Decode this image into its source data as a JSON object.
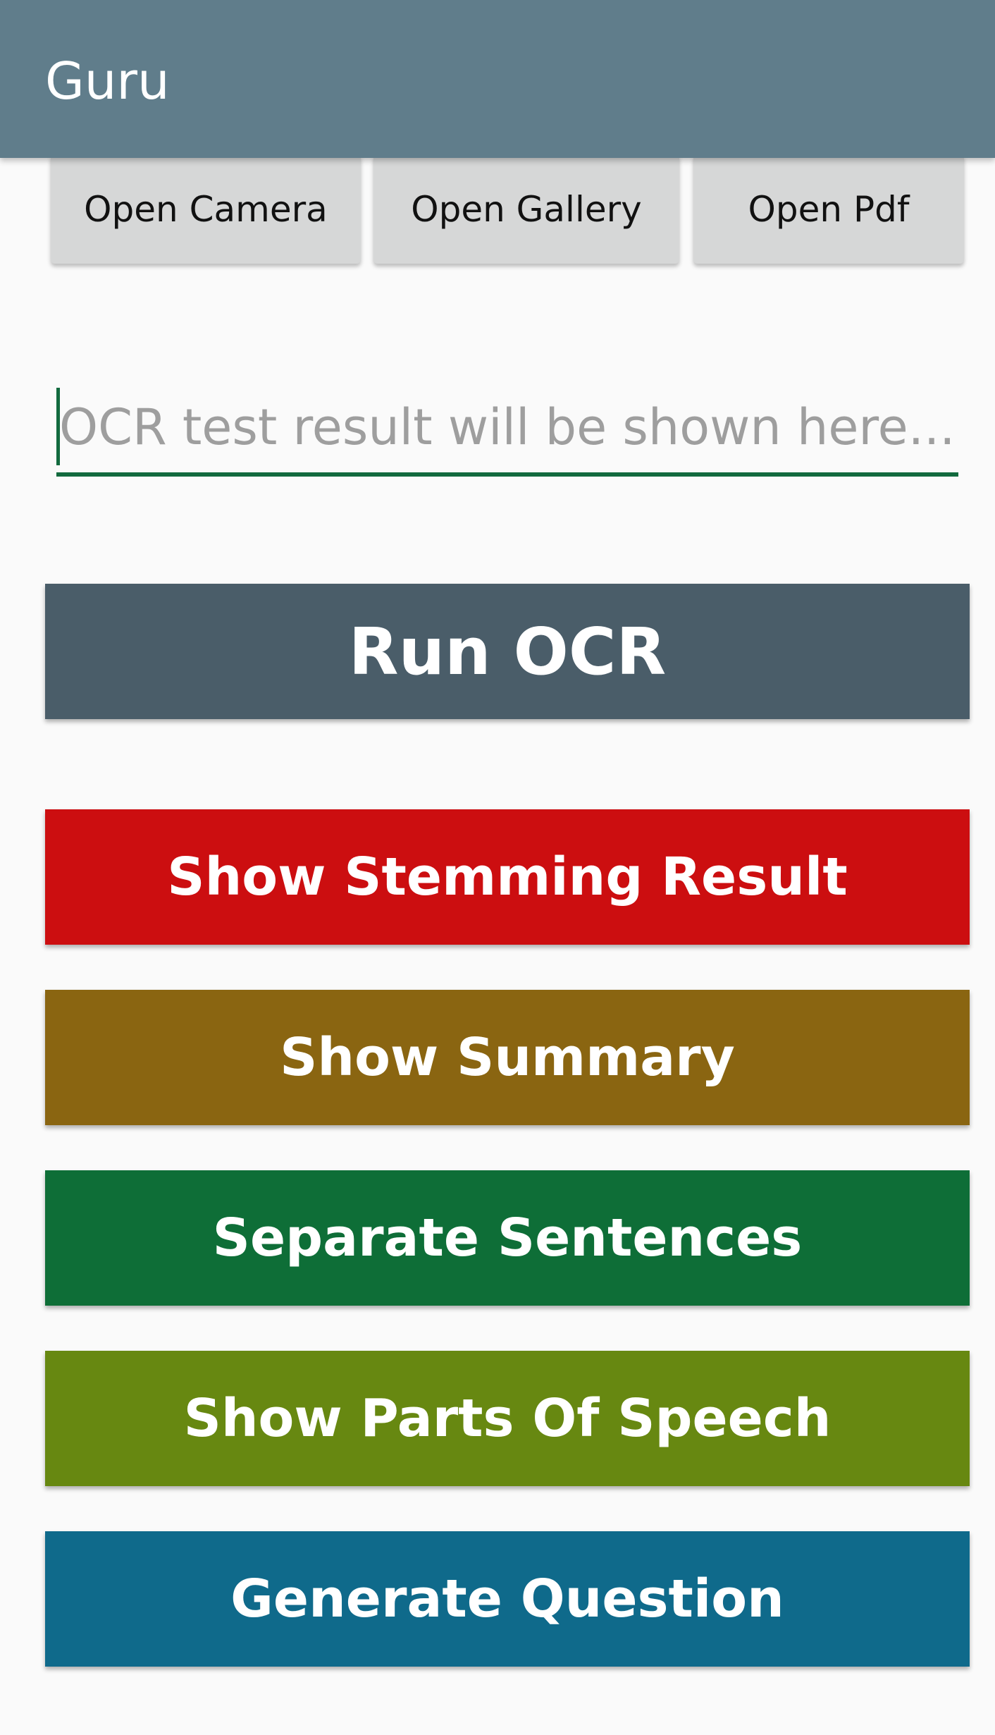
{
  "app_bar": {
    "title": "Guru",
    "background_color": "#607d8b"
  },
  "top_buttons": {
    "camera_label": "Open Camera",
    "gallery_label": "Open Gallery",
    "pdf_label": "Open Pdf"
  },
  "ocr_input": {
    "value": "",
    "placeholder": "OCR test result will be shown here..."
  },
  "actions": {
    "run_ocr": {
      "label": "Run OCR",
      "color": "#4a5d69"
    },
    "stemming": {
      "label": "Show Stemming Result",
      "color": "#cc0e10"
    },
    "summary": {
      "label": "Show Summary",
      "color": "#8a6511"
    },
    "sentences": {
      "label": "Separate Sentences",
      "color": "#0e6e37"
    },
    "pos": {
      "label": "Show Parts Of Speech",
      "color": "#678811"
    },
    "question": {
      "label": "Generate Question",
      "color": "#0f6a8b"
    }
  }
}
